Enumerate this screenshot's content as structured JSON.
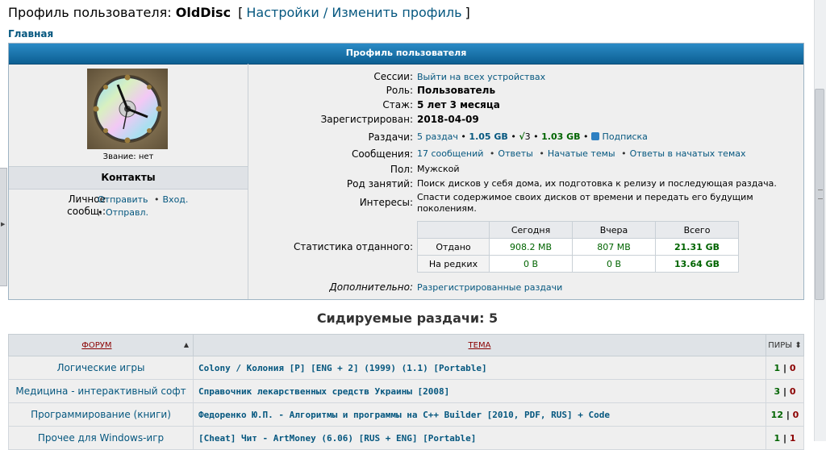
{
  "header": {
    "prefix": "Профиль пользователя:",
    "username": "OldDisc",
    "link": "Настройки / Изменить профиль",
    "bracket_open": "[",
    "bracket_close": "]"
  },
  "breadcrumb": "Главная",
  "profile": {
    "title": "Профиль пользователя",
    "rank": "Звание: нет",
    "contacts_title": "Контакты",
    "pm_label": "Личное сообщ.:",
    "pm_send": "Отправить",
    "pm_inbox": "Вход.",
    "pm_sent": "Отправл.",
    "bullet": "•",
    "fields": {
      "sessions_k": "Сессии:",
      "sessions_v": "Выйти на всех устройствах",
      "role_k": "Роль:",
      "role_v": "Пользователь",
      "tenure_k": "Стаж:",
      "tenure_v": "5 лет 3 месяца",
      "reg_k": "Зарегистрирован:",
      "reg_v": "2018-04-09",
      "rel_k": "Раздачи:",
      "rel_count": "5 раздач",
      "rel_size": "1.05 GB",
      "rel_check": "√",
      "rel_check_count": "3",
      "rel_check_size": "1.03 GB",
      "rel_sub": "Подписка",
      "msg_k": "Сообщения:",
      "msg_count": "17 сообщений",
      "msg_replies": "Ответы",
      "msg_topics": "Начатые темы",
      "msg_topic_replies": "Ответы в начатых темах",
      "gender_k": "Пол:",
      "gender_v": "Мужской",
      "occupation_k": "Род занятий:",
      "occupation_v": "Поиск дисков у себя дома, их подготовка к релизу и последующая раздача.",
      "interests_k": "Интересы:",
      "interests_v": "Спасти содержимое своих дисков от времени и передать его будущим поколениям.",
      "stats_k": "Статистика отданного:",
      "extra_k": "Дополнительно:",
      "extra_v": "Разрегистрированные раздачи"
    },
    "stats": {
      "cols": [
        "Сегодня",
        "Вчера",
        "Всего"
      ],
      "rows": [
        {
          "label": "Отдано",
          "today": "908.2 MB",
          "yesterday": "807 MB",
          "total": "21.31 GB"
        },
        {
          "label": "На редких",
          "today": "0 B",
          "yesterday": "0 B",
          "total": "13.64 GB"
        }
      ]
    }
  },
  "seeding": {
    "title": "Сидируемые раздачи: 5",
    "col_forum": "ФОРУМ",
    "col_topic": "ТЕМА",
    "col_peers": "ПИРЫ",
    "rows": [
      {
        "forum": "Логические игры",
        "topic": "Colony / Колония [P] [ENG + 2] (1999) (1.1) [Portable]",
        "seeds": "1",
        "leech": "0"
      },
      {
        "forum": "Медицина - интерактивный софт",
        "topic": "Справочник лекарственных средств Украины [2008]",
        "seeds": "3",
        "leech": "0"
      },
      {
        "forum": "Программирование (книги)",
        "topic": "Федоренко Ю.П. - Алгоритмы и программы на C++ Builder [2010, PDF, RUS] + Code",
        "seeds": "12",
        "leech": "0"
      },
      {
        "forum": "Прочее для Windows-игр",
        "topic": "[Cheat] Чит - ArtMoney (6.06) [RUS + ENG] [Portable]",
        "seeds": "1",
        "leech": "1"
      }
    ]
  },
  "colors": {
    "link": "#05577f",
    "header_blue": "#0c5f92",
    "green": "#006400",
    "red": "#8b0000"
  }
}
